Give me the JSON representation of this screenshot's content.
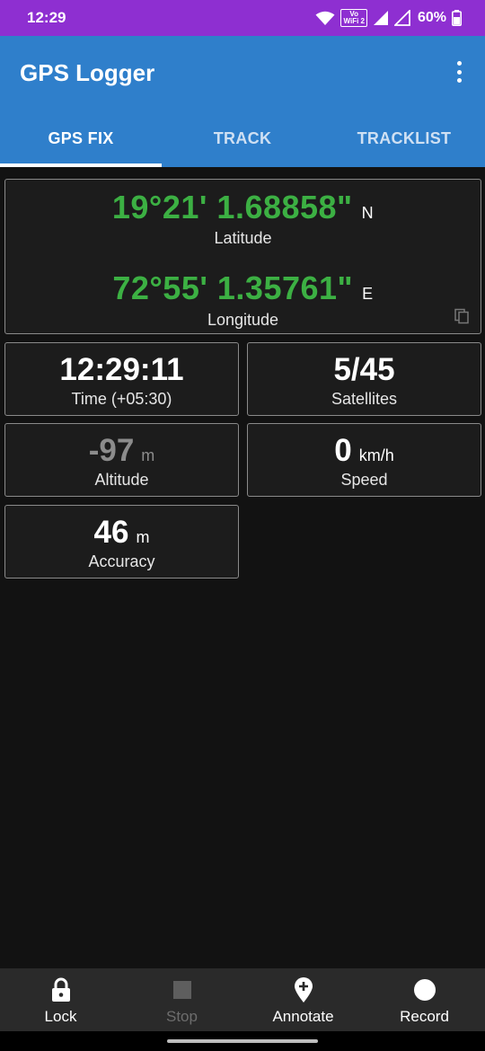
{
  "status_bar": {
    "time": "12:29",
    "volte_line1": "Vo",
    "volte_line2": "WiFi 2",
    "battery": "60%"
  },
  "app_bar": {
    "title": "GPS Logger",
    "tabs": [
      {
        "label": "GPS FIX",
        "active": true
      },
      {
        "label": "TRACK",
        "active": false
      },
      {
        "label": "TRACKLIST",
        "active": false
      }
    ]
  },
  "coordinates": {
    "latitude": {
      "value": "19°21' 1.68858\"",
      "hemisphere": "N",
      "label": "Latitude"
    },
    "longitude": {
      "value": "72°55' 1.35761\"",
      "hemisphere": "E",
      "label": "Longitude"
    }
  },
  "stats": {
    "time": {
      "value": "12:29:11",
      "label": "Time (+05:30)"
    },
    "satellites": {
      "value": "5/45",
      "label": "Satellites"
    },
    "altitude": {
      "value": "-97",
      "unit": "m",
      "label": "Altitude"
    },
    "speed": {
      "value": "0",
      "unit": "km/h",
      "label": "Speed"
    },
    "accuracy": {
      "value": "46",
      "unit": "m",
      "label": "Accuracy"
    }
  },
  "bottom_actions": [
    {
      "label": "Lock",
      "icon": "lock-icon",
      "enabled": true
    },
    {
      "label": "Stop",
      "icon": "stop-icon",
      "enabled": false
    },
    {
      "label": "Annotate",
      "icon": "add-location-icon",
      "enabled": true
    },
    {
      "label": "Record",
      "icon": "record-icon",
      "enabled": true
    }
  ],
  "colors": {
    "status_bar": "#8e2fd1",
    "app_bar": "#2f7fcb",
    "coordinate_green": "#3cb043",
    "background": "#121212"
  }
}
